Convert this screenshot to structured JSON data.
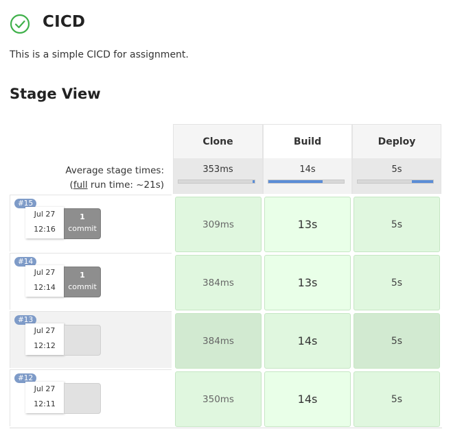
{
  "header": {
    "title": "CICD",
    "description": "This is a simple CICD for assignment.",
    "status_color": "#3fb04a"
  },
  "stage_view": {
    "title": "Stage View",
    "average_label": "Average stage times:",
    "full_run": {
      "prefix": "(",
      "link": "full",
      "suffix": " run time: ~21s)"
    },
    "stages": [
      {
        "name": "Clone",
        "avg": "353ms",
        "bar_fraction": 0.03
      },
      {
        "name": "Build",
        "avg": "14s",
        "bar_fraction": 0.72
      },
      {
        "name": "Deploy",
        "avg": "5s",
        "bar_fraction": 0.28
      }
    ],
    "runs": [
      {
        "number": "#15",
        "date": "Jul 27",
        "time": "12:16",
        "commits": "1",
        "commit_label": "commit",
        "durations": [
          "309ms",
          "13s",
          "5s"
        ]
      },
      {
        "number": "#14",
        "date": "Jul 27",
        "time": "12:14",
        "commits": "1",
        "commit_label": "commit",
        "durations": [
          "384ms",
          "13s",
          "5s"
        ]
      },
      {
        "number": "#13",
        "date": "Jul 27",
        "time": "12:12",
        "commits": "",
        "commit_label": "",
        "durations": [
          "384ms",
          "14s",
          "5s"
        ]
      },
      {
        "number": "#12",
        "date": "Jul 27",
        "time": "12:11",
        "commits": "",
        "commit_label": "",
        "durations": [
          "350ms",
          "14s",
          "5s"
        ]
      }
    ]
  }
}
